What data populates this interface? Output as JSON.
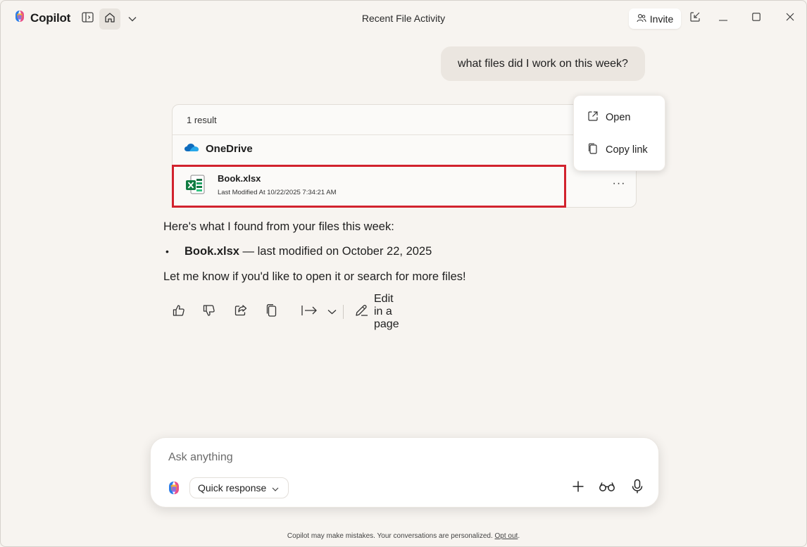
{
  "app": {
    "brand": "Copilot",
    "window_title": "Recent File Activity",
    "invite_label": "Invite"
  },
  "conversation": {
    "user_message": "what files did I work on this week?",
    "result_card": {
      "count_label": "1 result",
      "source": "OneDrive",
      "file": {
        "name": "Book.xlsx",
        "meta": "Last Modified At 10/22/2025 7:34:21 AM"
      },
      "more_label": "···"
    },
    "context_menu": {
      "items": [
        {
          "label": "Open",
          "icon": "open-external-icon"
        },
        {
          "label": "Copy link",
          "icon": "copy-icon"
        }
      ]
    },
    "response": {
      "intro": "Here's what I found from your files this week:",
      "bullet_marker": "•",
      "bullet_bold": "Book.xlsx",
      "bullet_rest": " — last modified on October 22, 2025",
      "closing": "Let me know if you'd like to open it or search for more files!"
    },
    "actions": {
      "edit_label": "Edit in a page"
    }
  },
  "composer": {
    "placeholder": "Ask anything",
    "mode": "Quick response"
  },
  "footer": {
    "text": "Copilot may make mistakes. Your conversations are personalized. ",
    "link": "Opt out",
    "end": "."
  },
  "colors": {
    "background": "#f7f4f0",
    "highlight_border": "#d2232e",
    "excel_green": "#1d7044",
    "onedrive_blue": "#0f6cbd"
  }
}
